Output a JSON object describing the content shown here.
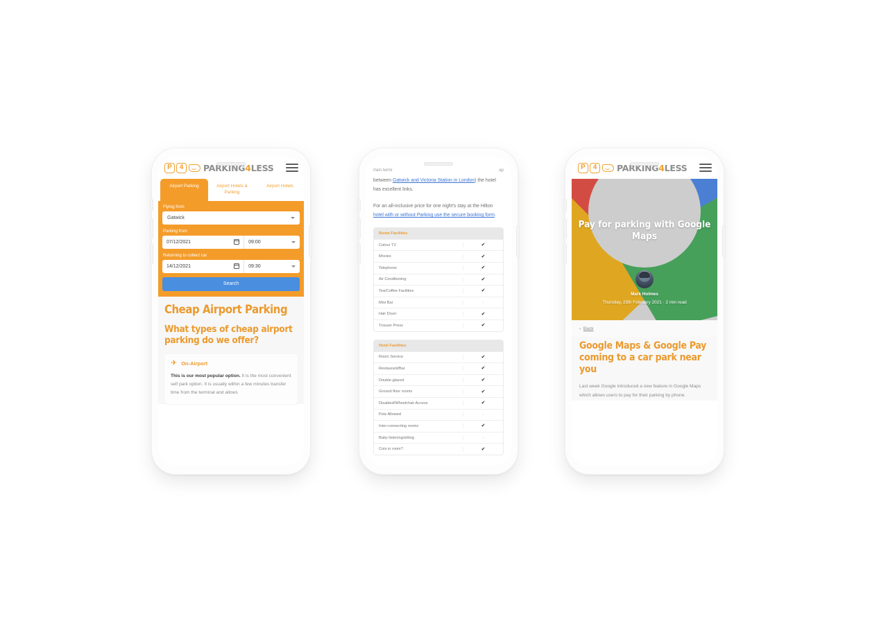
{
  "brand": {
    "logo_letter": "P",
    "logo_number": "4",
    "logo_word_main": "PARKING",
    "logo_word_num": "4",
    "logo_word_tail": "LESS",
    "accent_orange": "#f0a030",
    "heading_orange": "#eb9a2e",
    "panel_orange": "#f49c2a",
    "search_blue": "#4a8ee0",
    "link_blue": "#3b74d6"
  },
  "phone1": {
    "menu_icon": "hamburger-icon",
    "tabs": [
      {
        "label": "Airport Parking",
        "active": true
      },
      {
        "label": "Airport Hotels & Parking",
        "active": false
      },
      {
        "label": "Airport Hotels",
        "active": false
      }
    ],
    "form": {
      "flying_from_label": "Flying from",
      "flying_from_value": "Gatwick",
      "parking_from_label": "Parking from",
      "parking_from_date": "07/12/2021",
      "parking_from_time": "09:00",
      "returning_label": "Returning to collect car",
      "returning_date": "14/12/2021",
      "returning_time": "09:30",
      "search_label": "Search"
    },
    "content": {
      "h1": "Cheap Airport Parking",
      "h2": "What types of cheap airport parking do we offer?",
      "card_icon": "airplane-icon",
      "card_title": "On-Airport",
      "card_body_bold": "This is our most popular option.",
      "card_body_rest": " It is the most convenient self park option. It is usually within a few minutes transfer time from the terminal and allows"
    }
  },
  "phone2": {
    "clipped_left": "rtain termi",
    "clipped_right": "ap",
    "para1_pre": "between ",
    "para1_link": "Gatwick and Victoria Station in London",
    "para1_post": ") the hotel has excellent links.",
    "para2_pre": "For an all-inclusive price for one night's stay at the Hilton ",
    "para2_link": "hotel with or without Parking use the secure booking form",
    "para2_post": ".",
    "room_table": {
      "header": "Room Facilities",
      "rows": [
        {
          "name": "Colour TV",
          "value": "✔"
        },
        {
          "name": "Movies",
          "value": "✔"
        },
        {
          "name": "Telephone",
          "value": "✔"
        },
        {
          "name": "Air Conditioning",
          "value": "✔"
        },
        {
          "name": "Tea/Coffee Facilities",
          "value": "✔"
        },
        {
          "name": "Mini Bar",
          "value": "-"
        },
        {
          "name": "Hair Dryer",
          "value": "✔"
        },
        {
          "name": "Trouser Press",
          "value": "✔"
        }
      ]
    },
    "hotel_table": {
      "header": "Hotel Facilities",
      "rows": [
        {
          "name": "Room Service",
          "value": "✔"
        },
        {
          "name": "Restaurant/Bar",
          "value": "✔"
        },
        {
          "name": "Double-glazed",
          "value": "✔"
        },
        {
          "name": "Ground floor rooms",
          "value": "✔"
        },
        {
          "name": "Disabled/Wheelchair Access",
          "value": "✔"
        },
        {
          "name": "Pets Allowed",
          "value": "-"
        },
        {
          "name": "Inter-connecting rooms",
          "value": "✔"
        },
        {
          "name": "Baby listening/sitting",
          "value": "-"
        },
        {
          "name": "Cots in room?",
          "value": "✔"
        }
      ]
    }
  },
  "phone3": {
    "menu_icon": "hamburger-icon",
    "hero_title": "Pay for parking with Google Maps",
    "author": "Mark Holmes",
    "meta": "Thursday, 25th February 2021 · 2 min read",
    "back_label": "Back",
    "blog_title": "Google Maps & Google Pay coming to a car park near you",
    "blog_paragraph": "Last week Google introduced a new feature in Google Maps which allows users to pay for their parking by phone.",
    "hero_colors": {
      "red": "#d34c43",
      "blue": "#4a7fd4",
      "yellow": "#dfa721",
      "green": "#46a05a",
      "grey": "#cdcdcd"
    }
  }
}
